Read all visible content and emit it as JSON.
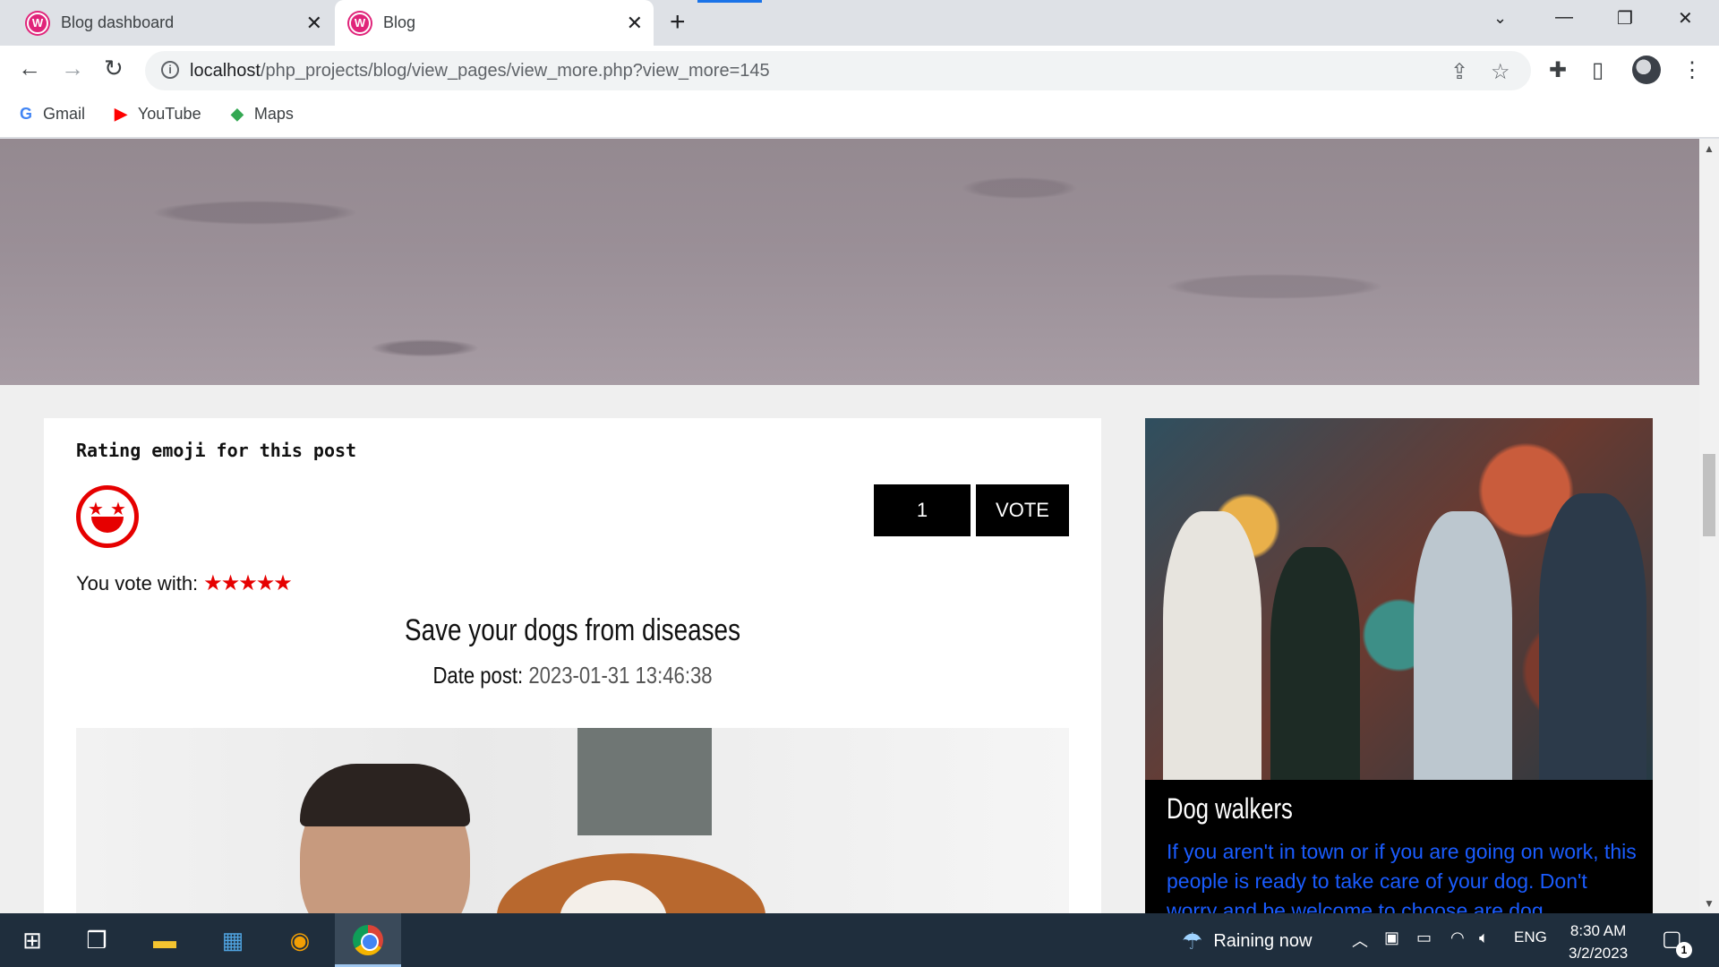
{
  "tabs": [
    {
      "label": "Blog dashboard",
      "active": false
    },
    {
      "label": "Blog",
      "active": true
    }
  ],
  "address_bar": {
    "host": "localhost",
    "path": "/php_projects/blog/view_pages/view_more.php?view_more=145"
  },
  "bookmarks": [
    {
      "label": "Gmail",
      "icon": "google-icon"
    },
    {
      "label": "YouTube",
      "icon": "youtube-icon"
    },
    {
      "label": "Maps",
      "icon": "maps-icon"
    }
  ],
  "post": {
    "rating_title": "Rating emoji for this post",
    "vote_count": "1",
    "vote_label": "VOTE",
    "vote_with_label": "You vote with:",
    "stars": "★★★★★",
    "stars_rating": 5,
    "title": "Save your dogs from diseases",
    "date_label": "Date post:",
    "date_value": "2023-01-31 13:46:38"
  },
  "sidebar_card": {
    "title": "Dog walkers",
    "text": "If you aren't in town or if you are going on work, this people is ready to take care of your dog. Don't worry and be welcome to choose are dog"
  },
  "taskbar": {
    "weather": "Raining now",
    "language": "ENG",
    "time": "8:30 AM",
    "date": "3/2/2023",
    "notifications": "1"
  },
  "colors": {
    "accent_red": "#e60000",
    "link_blue": "#1a5cff",
    "favicon_pink": "#e0247a"
  }
}
